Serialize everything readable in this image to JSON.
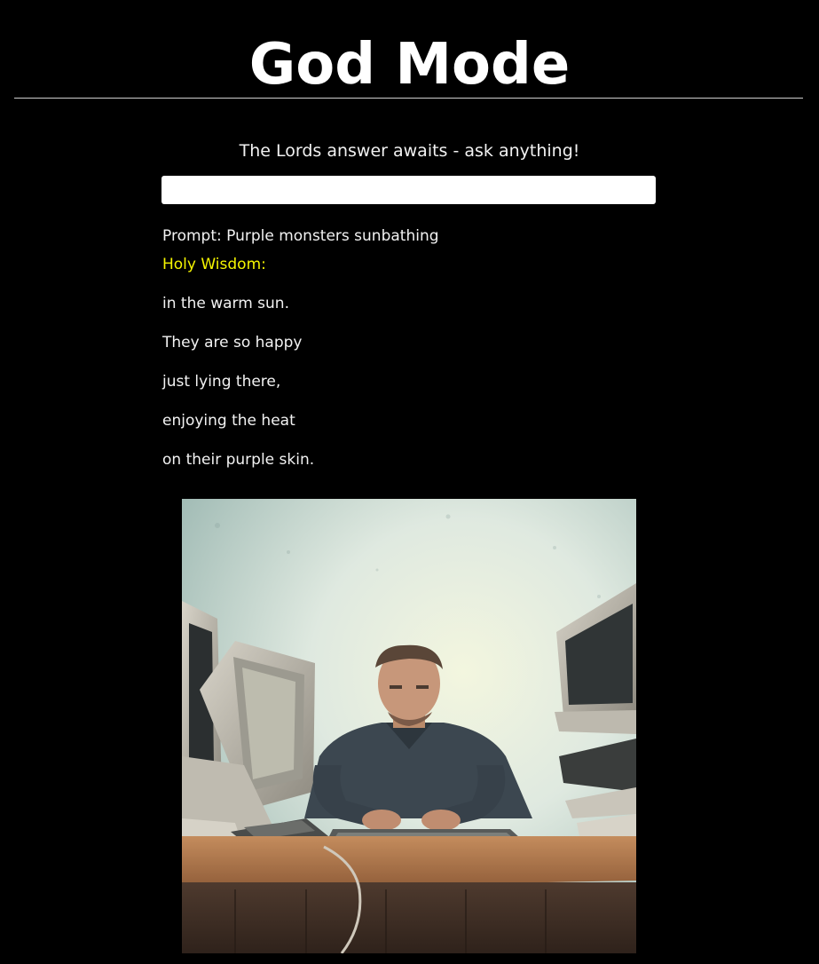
{
  "header": {
    "title": "God Mode"
  },
  "main": {
    "subtitle": "The Lords answer awaits - ask anything!",
    "input": {
      "value": "",
      "placeholder": ""
    },
    "prompt_text": "Prompt: Purple monsters sunbathing",
    "wisdom_label": "Holy Wisdom:",
    "answer_lines": [
      "in the warm sun.",
      "They are so happy",
      "just lying there,",
      "enjoying the heat",
      "on their purple skin."
    ],
    "image": {
      "subject": "man-typing-at-computer-desk",
      "colors": {
        "wall_top": "#9eb9b3",
        "wall_glow": "#f3f6df",
        "desk": "#a57148",
        "desk_front": "#3f2d23",
        "sweater": "#3c4750"
      }
    }
  }
}
